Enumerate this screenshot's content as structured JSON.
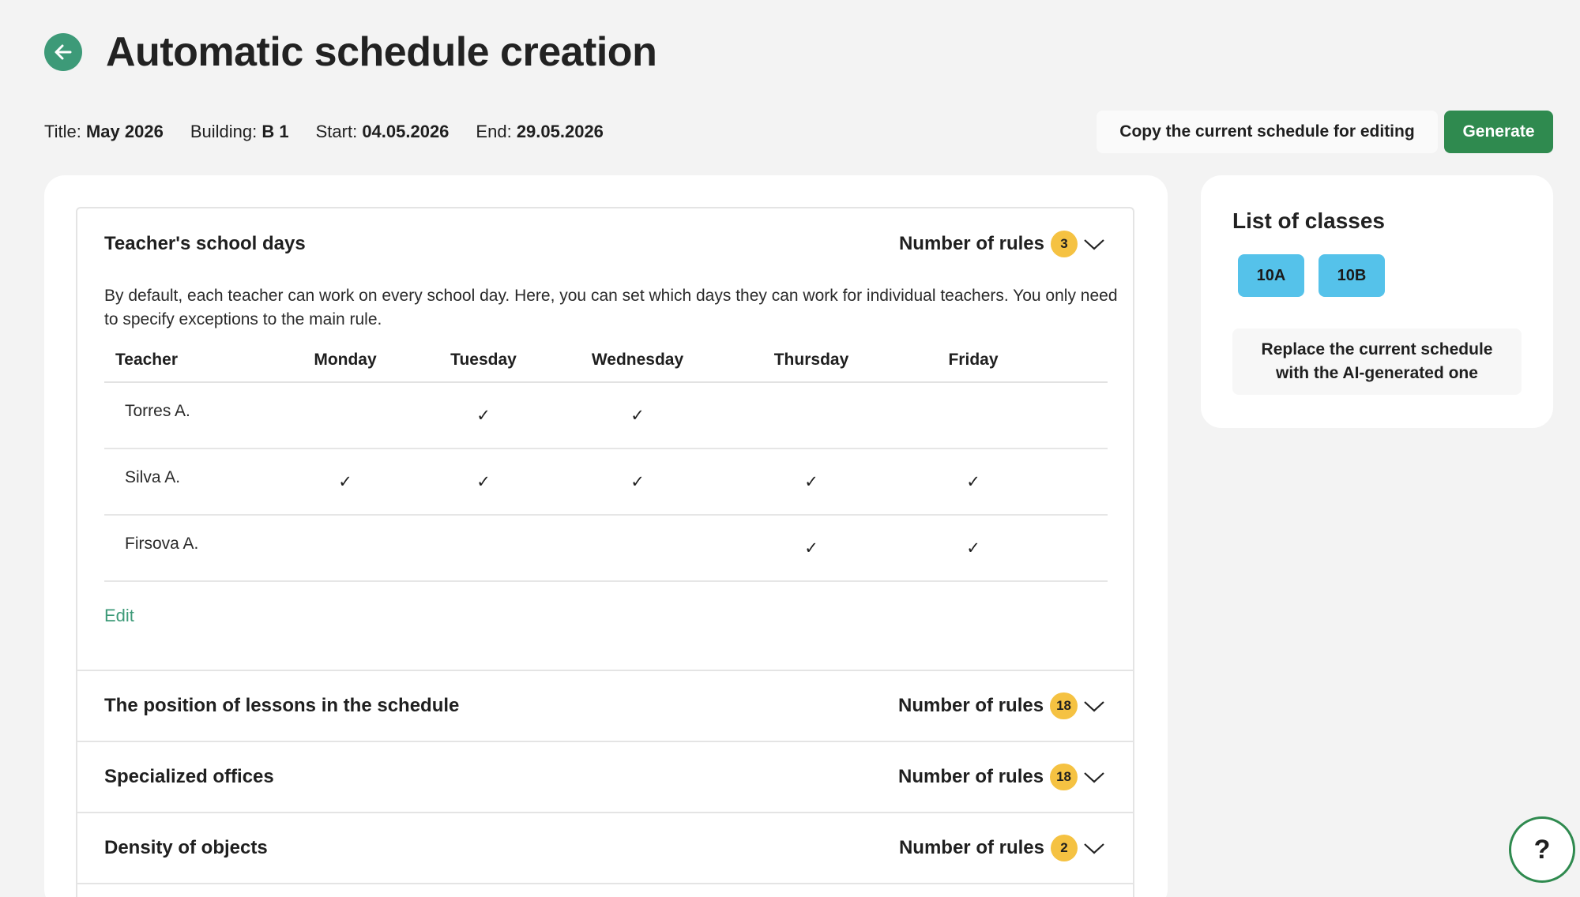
{
  "header": {
    "title": "Automatic schedule creation"
  },
  "meta": {
    "title_label": "Title:",
    "title_value": "May 2026",
    "building_label": "Building:",
    "building_value": "B 1",
    "start_label": "Start:",
    "start_value": "04.05.2026",
    "end_label": "End:",
    "end_value": "29.05.2026"
  },
  "actions": {
    "copy_label": "Copy the current schedule for editing",
    "generate_label": "Generate"
  },
  "sections": [
    {
      "title": "Teacher's school days",
      "rules_label": "Number of rules",
      "rules_count": "3",
      "description": "By default, each teacher can work on every school day. Here, you can set which days they can work for individual teachers. You only need to specify exceptions to the main rule.",
      "table": {
        "headers": [
          "Teacher",
          "Monday",
          "Tuesday",
          "Wednesday",
          "Thursday",
          "Friday"
        ],
        "rows": [
          {
            "name": "Torres A.",
            "days": [
              "",
              "✓",
              "✓",
              "",
              ""
            ]
          },
          {
            "name": "Silva A.",
            "days": [
              "✓",
              "✓",
              "✓",
              "✓",
              "✓"
            ]
          },
          {
            "name": "Firsova A.",
            "days": [
              "",
              "",
              "",
              "✓",
              "✓"
            ]
          }
        ]
      },
      "edit_label": "Edit"
    },
    {
      "title": "The position of lessons in the schedule",
      "rules_label": "Number of rules",
      "rules_count": "18"
    },
    {
      "title": "Specialized offices",
      "rules_label": "Number of rules",
      "rules_count": "18"
    },
    {
      "title": "Density of objects",
      "rules_label": "Number of rules",
      "rules_count": "2"
    }
  ],
  "classes": {
    "title": "List of classes",
    "items": [
      "10A",
      "10B"
    ],
    "replace_label": "Replace the current schedule with the AI-generated one"
  },
  "help": {
    "label": "?"
  },
  "colors": {
    "accent_green": "#3d9a78",
    "generate_green": "#2f8a4f",
    "badge_yellow": "#f5c242",
    "chip_blue": "#55c2ea"
  },
  "icons": {
    "back": "arrow-left-icon",
    "expand": "chevron-down-icon",
    "check": "checkmark-icon"
  }
}
